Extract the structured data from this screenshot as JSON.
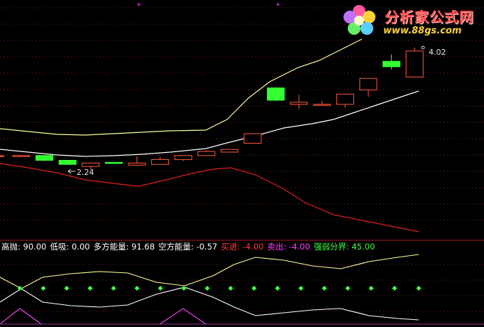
{
  "logo": {
    "title": "分析家公式网",
    "url": "www.88gs.com"
  },
  "price_labels": {
    "high": "4.02",
    "low": "2.24"
  },
  "indicators": [
    {
      "label": "高抛: 90.00",
      "color": "#ffffff"
    },
    {
      "label": "低吸: 0.00",
      "color": "#ffffff"
    },
    {
      "label": "多方能量: 91.68",
      "color": "#ffffff"
    },
    {
      "label": "空方能量: -0.57",
      "color": "#ffffff"
    },
    {
      "label": "买进: -4.00",
      "color": "#ff3b3b"
    },
    {
      "label": "卖出: -4.00",
      "color": "#ff40ff"
    },
    {
      "label": "强弱分界: 45.00",
      "color": "#40ff40"
    }
  ],
  "colors": {
    "up_candle": "#ff5a3c",
    "down_candle": "#33ff33",
    "upper_band": "#ffff99",
    "middle_band": "#ffffff",
    "red_line": "#e02020",
    "grid": "#8a2222",
    "dots": "#40ff40",
    "magenta": "#ff40ff"
  },
  "candles": [
    {
      "o": 2.44,
      "h": 2.45,
      "l": 2.43,
      "c": 2.44
    },
    {
      "o": 2.44,
      "h": 2.45,
      "l": 2.36,
      "c": 2.37
    },
    {
      "o": 2.37,
      "h": 2.37,
      "l": 2.31,
      "c": 2.31
    },
    {
      "o": 2.28,
      "h": 2.33,
      "l": 2.24,
      "c": 2.33
    },
    {
      "o": 2.34,
      "h": 2.34,
      "l": 2.33,
      "c": 2.33
    },
    {
      "o": 2.3,
      "h": 2.43,
      "l": 2.29,
      "c": 2.33
    },
    {
      "o": 2.31,
      "h": 2.42,
      "l": 2.31,
      "c": 2.38
    },
    {
      "o": 2.38,
      "h": 2.44,
      "l": 2.36,
      "c": 2.44
    },
    {
      "o": 2.44,
      "h": 2.52,
      "l": 2.44,
      "c": 2.5
    },
    {
      "o": 2.49,
      "h": 2.53,
      "l": 2.49,
      "c": 2.53
    },
    {
      "o": 2.62,
      "h": 2.76,
      "l": 2.62,
      "c": 2.76
    },
    {
      "o": 3.43,
      "h": 3.44,
      "l": 3.24,
      "c": 3.25
    },
    {
      "o": 3.19,
      "h": 3.33,
      "l": 3.12,
      "c": 3.22
    },
    {
      "o": 3.19,
      "h": 3.24,
      "l": 3.19,
      "c": 3.19
    },
    {
      "o": 3.19,
      "h": 3.34,
      "l": 3.14,
      "c": 3.34
    },
    {
      "o": 3.4,
      "h": 3.57,
      "l": 3.3,
      "c": 3.57
    },
    {
      "o": 3.82,
      "h": 3.92,
      "l": 3.7,
      "c": 3.74
    },
    {
      "o": 3.59,
      "h": 4.02,
      "l": 3.59,
      "c": 3.97
    }
  ]
}
